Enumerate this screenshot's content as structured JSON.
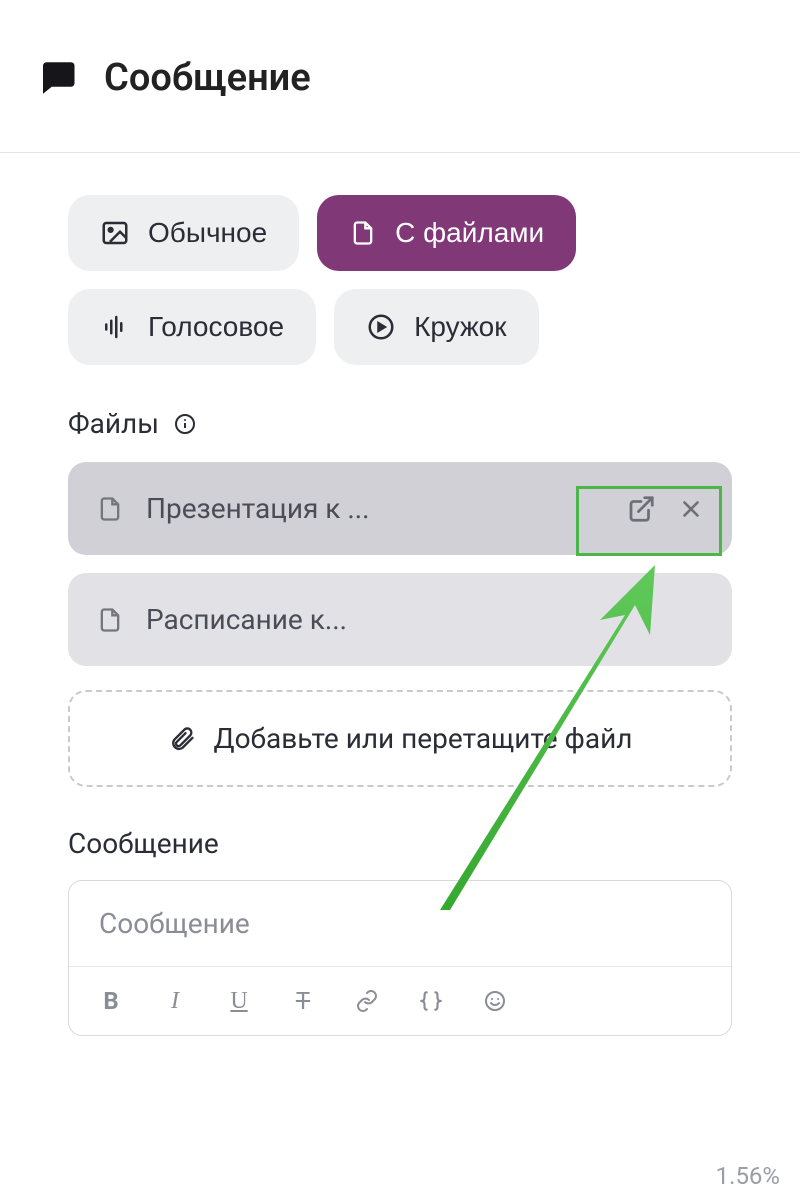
{
  "header": {
    "title": "Сообщение"
  },
  "tabs": {
    "regular": "Обычное",
    "files": "С файлами",
    "voice": "Голосовое",
    "circle": "Кружок"
  },
  "files": {
    "label": "Файлы",
    "items": [
      {
        "name": "Презентация к ..."
      },
      {
        "name": "Расписание к..."
      }
    ],
    "dropzone": "Добавьте или перетащите файл"
  },
  "message": {
    "label": "Сообщение",
    "placeholder": "Сообщение"
  },
  "footer": {
    "percent": "1.56%"
  },
  "colors": {
    "accent": "#803877",
    "highlight": "#4db648"
  }
}
